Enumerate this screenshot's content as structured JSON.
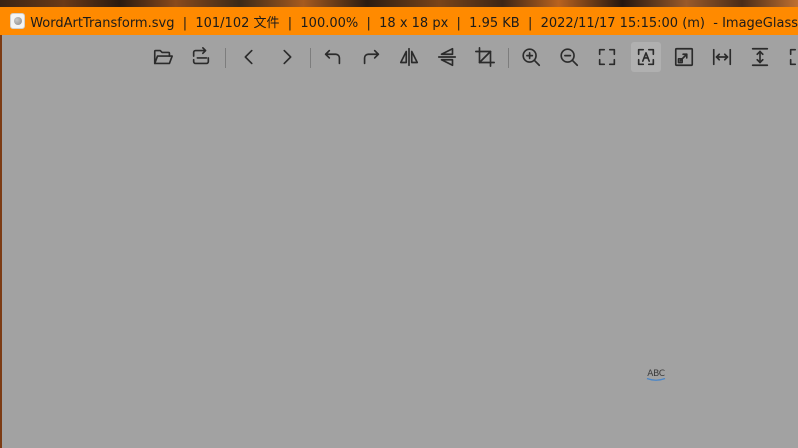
{
  "window": {
    "title": "WordArtTransform.svg  |  101/102 文件  |  100.00%  |  18 x 18 px  |  1.95 KB  |  2022/11/17 15:15:00 (m)  - ImageGlass",
    "accent_color": "#ff8a00",
    "canvas_color": "#a2a2a2"
  },
  "toolbar": {
    "buttons": [
      {
        "id": "open",
        "icon": "folder-open-icon"
      },
      {
        "id": "refresh",
        "icon": "refresh-icon"
      },
      {
        "id": "previous",
        "icon": "chevron-left-icon"
      },
      {
        "id": "next",
        "icon": "chevron-right-icon"
      },
      {
        "id": "rotate-left",
        "icon": "rotate-left-icon"
      },
      {
        "id": "rotate-right",
        "icon": "rotate-right-icon"
      },
      {
        "id": "flip-horizontal",
        "icon": "flip-horizontal-icon"
      },
      {
        "id": "flip-vertical",
        "icon": "flip-vertical-icon"
      },
      {
        "id": "crop",
        "icon": "crop-icon"
      },
      {
        "id": "zoom-in",
        "icon": "zoom-in-icon"
      },
      {
        "id": "zoom-out",
        "icon": "zoom-out-icon"
      },
      {
        "id": "auto-zoom",
        "icon": "fullscreen-corners-icon"
      },
      {
        "id": "lock-zoom",
        "icon": "lock-zoom-icon",
        "active": true
      },
      {
        "id": "scale-to-fit",
        "icon": "scale-to-fit-icon"
      },
      {
        "id": "scale-to-width",
        "icon": "scale-to-width-icon"
      },
      {
        "id": "scale-to-height",
        "icon": "scale-to-height-icon"
      },
      {
        "id": "scale-to-fill",
        "icon": "scale-to-fill-icon"
      }
    ]
  },
  "image": {
    "text": "ABC"
  }
}
